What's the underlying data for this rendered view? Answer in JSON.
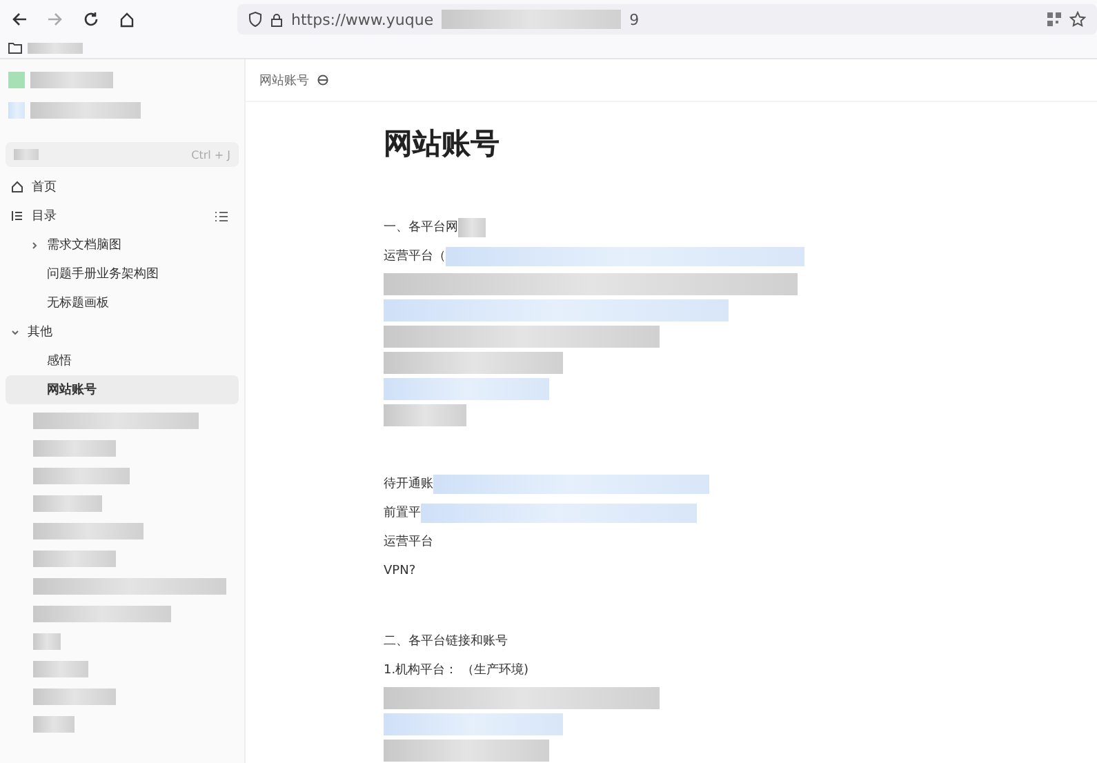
{
  "browser": {
    "url_start": "https://www.yuque",
    "url_end": "9"
  },
  "sidebar": {
    "search": {
      "shortcut": "Ctrl + J"
    },
    "items": [
      {
        "kind": "home",
        "label": "首页",
        "selected": false
      },
      {
        "kind": "toc",
        "label": "目录",
        "selected": false,
        "children": [
          {
            "kind": "doc",
            "label": "需求文档脑图",
            "selected": false,
            "expanded": false
          },
          {
            "kind": "doc",
            "label": "问题手册业务架构图",
            "selected": false
          },
          {
            "kind": "doc",
            "label": "无标题画板",
            "selected": false
          }
        ]
      },
      {
        "kind": "group",
        "label": "其他",
        "selected": false,
        "expanded": true,
        "children": [
          {
            "kind": "doc",
            "label": "感悟",
            "selected": false
          },
          {
            "kind": "doc",
            "label": "网站账号",
            "selected": true
          }
        ]
      }
    ]
  },
  "document": {
    "breadcrumb": "网站账号",
    "title": "网站账号",
    "lines": [
      {
        "kind": "text",
        "text": "一、各平台网",
        "blurred": true
      },
      {
        "kind": "text",
        "text": "运营平台（",
        "blurred": true
      },
      {
        "kind": "blur"
      },
      {
        "kind": "blur"
      },
      {
        "kind": "blur"
      },
      {
        "kind": "blur"
      },
      {
        "kind": "blur"
      },
      {
        "kind": "blur"
      },
      {
        "kind": "gap"
      },
      {
        "kind": "text",
        "text": "待开通账",
        "blurred": true
      },
      {
        "kind": "text",
        "text": "前置平",
        "blurred": true
      },
      {
        "kind": "text",
        "text": "运营平台",
        "blurred": false
      },
      {
        "kind": "text",
        "text": "VPN?",
        "blurred": false
      },
      {
        "kind": "gap"
      },
      {
        "kind": "text",
        "text": "二、各平台链接和账号",
        "blurred": false
      },
      {
        "kind": "text",
        "text": "1.机构平台： （生产环境)",
        "blurred": false
      },
      {
        "kind": "blur"
      },
      {
        "kind": "blur"
      },
      {
        "kind": "blur"
      }
    ]
  }
}
